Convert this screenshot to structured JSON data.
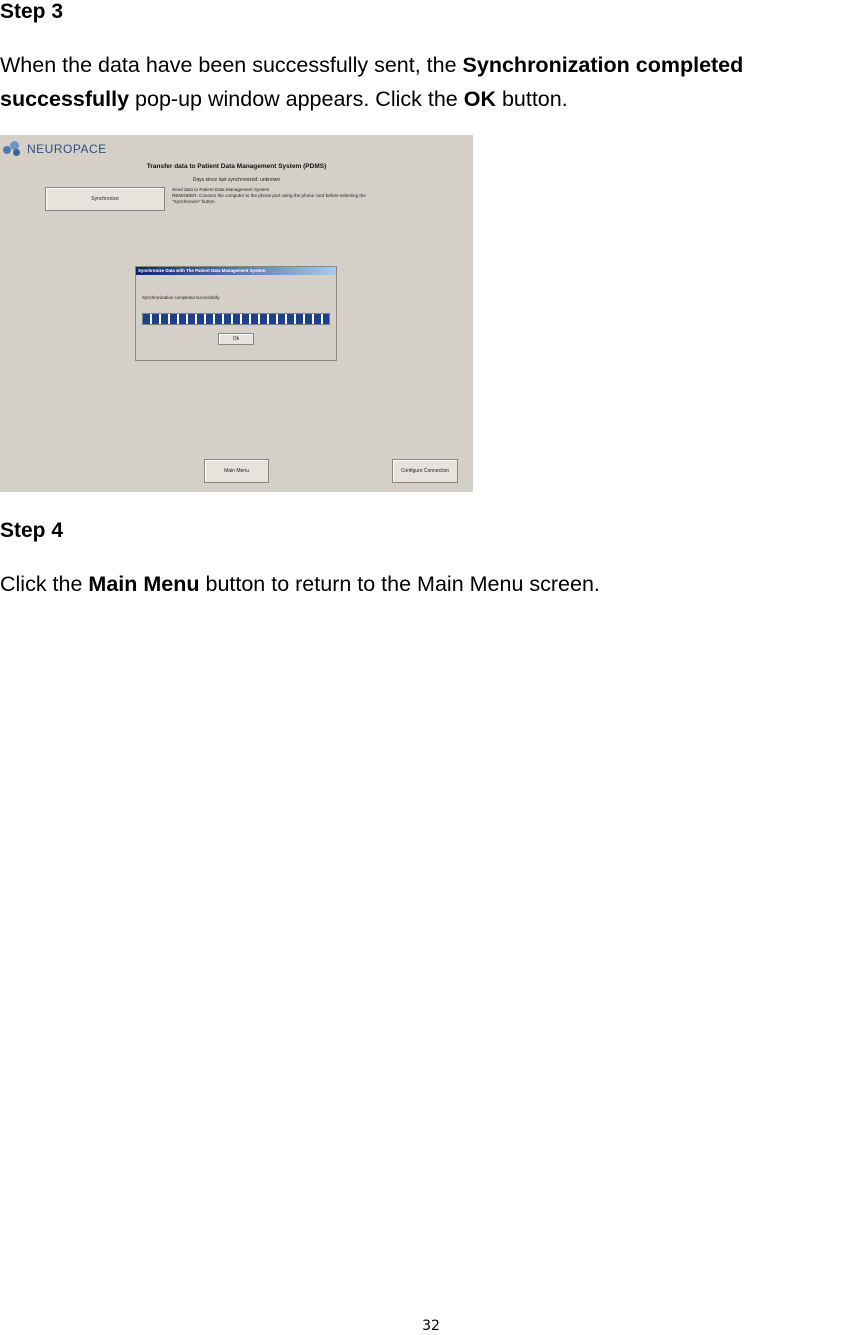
{
  "step3": {
    "heading": "Step 3",
    "line1_prefix": "When the data have been successfully sent, the ",
    "line1_bold": "Synchronization completed",
    "line2_bold": "successfully",
    "line2_middle": " pop-up window appears. Click the ",
    "line2_bold2": "OK",
    "line2_suffix": " button."
  },
  "screenshot": {
    "logo_text": "NEUROPACE",
    "title": "Transfer data to Patient Data Management System (PDMS)",
    "days_since": "Days since last synchronized: unknown",
    "synchronize_label": "Synchronize",
    "reminder_line1": "Send data to Patient Data Management System",
    "reminder_line2": "REMINDER: Connect the computer to the phone port using the phone cord before selecting the",
    "reminder_line3": "\"Synchronize\" button",
    "dialog": {
      "title": "Synchronize Data with The Patient Data Management System",
      "message": "Synchronization completed successfully",
      "progress": 1.0,
      "ok_label": "Ok"
    },
    "main_menu_label": "Main Menu",
    "configure_label": "Configure Connection",
    "colors": {
      "background": "#d4d0c8",
      "progress": "#1c3f8f",
      "titlebar": "#0a246a"
    }
  },
  "step4": {
    "heading": "Step 4",
    "prefix": "Click the ",
    "bold": "Main Menu",
    "suffix": " button to return to the Main Menu screen."
  },
  "page_number": "32"
}
